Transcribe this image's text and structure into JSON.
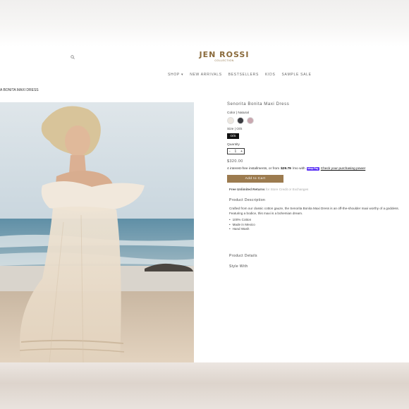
{
  "header": {
    "logo_main": "JEN ROSSI",
    "logo_sub": "COLLECTION"
  },
  "nav": {
    "items": [
      "SHOP ▾",
      "NEW ARRIVALS",
      "BESTSELLERS",
      "KIDS",
      "SAMPLE SALE"
    ]
  },
  "breadcrumb": "A BONITA MAXI DRESS",
  "product": {
    "title": "Senorita Bonita Maxi Dress",
    "color_label": "Color | Natural",
    "swatch_colors": [
      "#ece6df",
      "#3a3b40",
      "#c9a8b0"
    ],
    "size_label": "Size | O/S",
    "size_option": "O/S",
    "quantity_label": "Quantity",
    "quantity": {
      "minus": "-",
      "value": "1",
      "plus": "+"
    },
    "price": "$320.00",
    "installments": {
      "prefix": "4 interest-free installments, or from",
      "amount": "$29.79",
      "suffix": "/mo with",
      "badge": "shop Pay",
      "link": "Check your purchasing power"
    },
    "add_to_cart": "Add to Cart",
    "returns": {
      "bold": "Free Unlimited Returns",
      "rest": "for Store Credit or Exchanges"
    },
    "description_heading": "Product Description",
    "description": "Crafted from our classic cotton gauze, the Senorita Bonita Maxi Dress is an off-the-shoulder maxi worthy of a goddess. Featuring a bodice, this maxi is a bohemian dream.",
    "bullets": [
      "100% Cotton",
      "Made in Mexico",
      "Hand Wash"
    ],
    "details_heading": "Product Details",
    "style_heading": "Style With"
  },
  "colors": {
    "brand": "#8a6a3b",
    "cart_button": "#9c7b4f",
    "shop_pay": "#5a31f4"
  }
}
